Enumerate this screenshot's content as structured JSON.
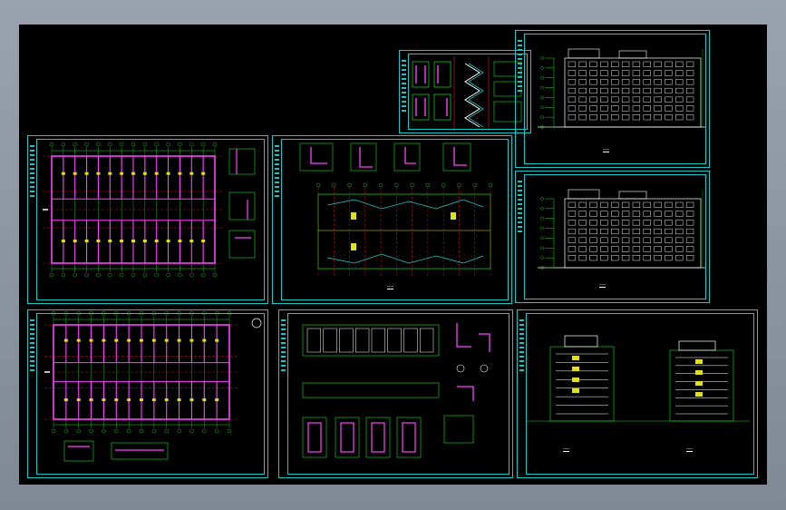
{
  "viewer": {
    "background_color": "#8e97a1",
    "canvas_color": "#000000",
    "frame_color": "#18c8c8",
    "line_colors": {
      "grid": "#18e018",
      "wall": "#ff40ff",
      "axis": "#ff2020",
      "text": "#ffffff",
      "dim": "#e0e020",
      "frame": "#18c8c8"
    }
  },
  "sheets": [
    {
      "id": "stair-details",
      "drawing": "details-stair"
    },
    {
      "id": "elevation-front",
      "drawing": "elevation-long"
    },
    {
      "id": "floor-plan-1",
      "drawing": "plan-a"
    },
    {
      "id": "roof-plan",
      "drawing": "plan-roof"
    },
    {
      "id": "elevation-rear",
      "drawing": "elevation-long"
    },
    {
      "id": "floor-plan-2",
      "drawing": "plan-b"
    },
    {
      "id": "wall-details",
      "drawing": "details-wall"
    },
    {
      "id": "side-elevations",
      "drawing": "elevation-side"
    }
  ]
}
